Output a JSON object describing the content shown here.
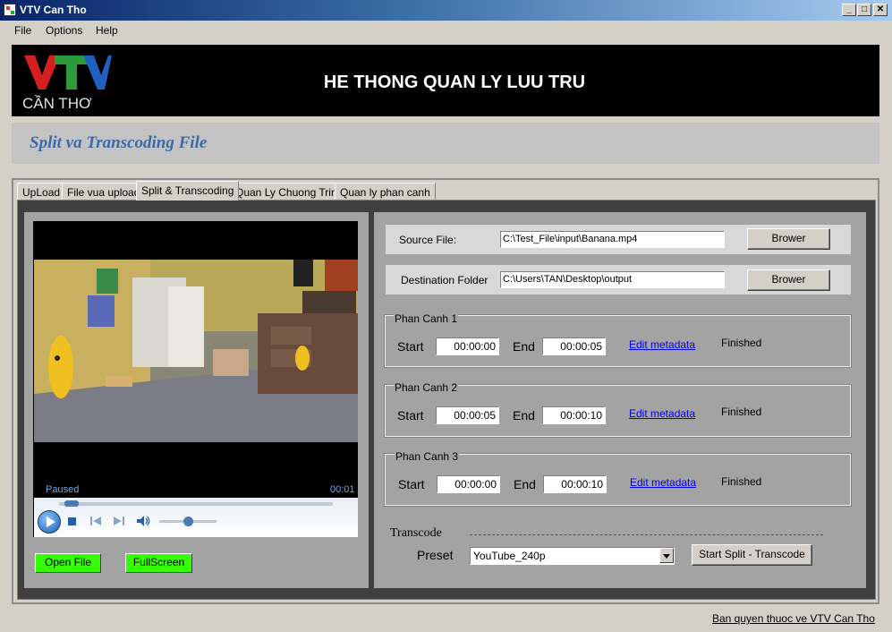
{
  "window": {
    "title": "VTV Can Tho"
  },
  "menu": [
    "File",
    "Options",
    "Help"
  ],
  "banner": {
    "logo_text": "VTV",
    "logo_subtext": "CẦN THƠ",
    "title": "HE THONG QUAN LY LUU TRU"
  },
  "subtitle": "Split va Transcoding File",
  "tabs": [
    {
      "label": "UpLoad",
      "active": false
    },
    {
      "label": "File vua upload",
      "active": false
    },
    {
      "label": "Split & Transcoding",
      "active": true
    },
    {
      "label": "Quan Ly Chuong Trinh",
      "active": false
    },
    {
      "label": "Quan ly phan canh",
      "active": false
    }
  ],
  "player": {
    "state": "Paused",
    "time": "00:01",
    "seek_fraction": 0.02,
    "volume_fraction": 0.5
  },
  "left_buttons": {
    "open_file": "Open File",
    "fullscreen": "FullScreen"
  },
  "source": {
    "label": "Source File:",
    "value": "C:\\Test_File\\input\\Banana.mp4",
    "button": "Brower"
  },
  "destination": {
    "label": "Destination Folder",
    "value": "C:\\Users\\TAN\\Desktop\\output",
    "button": "Brower"
  },
  "scenes": [
    {
      "title": "Phan Canh 1",
      "start_label": "Start",
      "start": "00:00:00",
      "end_label": "End",
      "end": "00:00:05",
      "link": "Edit metadata",
      "status": "Finished"
    },
    {
      "title": "Phan Canh 2",
      "start_label": "Start",
      "start": "00:00:05",
      "end_label": "End",
      "end": "00:00:10",
      "link": "Edit metadata",
      "status": "Finished"
    },
    {
      "title": "Phan Canh 3",
      "start_label": "Start",
      "start": "00:00:00",
      "end_label": "End",
      "end": "00:00:10",
      "link": "Edit metadata",
      "status": "Finished"
    }
  ],
  "transcode": {
    "label": "Transcode",
    "preset_label": "Preset",
    "preset_value": "YouTube_240p",
    "start_button": "Start Split - Transcode"
  },
  "footer": "Ban quyen thuoc ve VTV Can Tho",
  "colors": {
    "accent_green": "#33ff00",
    "subtitle_blue": "#3c6aa8",
    "logo_red": "#d62020"
  }
}
